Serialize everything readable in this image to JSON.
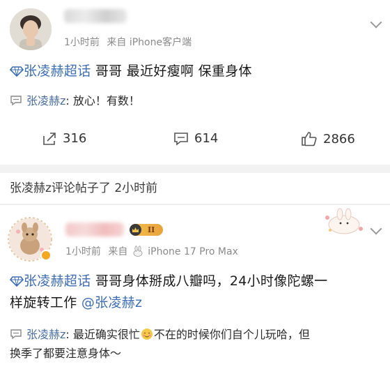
{
  "post1": {
    "time": "1小时前",
    "source_prefix": "来自",
    "source_device": "iPhone客户端",
    "topic": "张凌赫超话",
    "text": " 哥哥 最近好瘦啊 保重身体",
    "comment_user": "张凌赫z",
    "comment_text": ": 放心！有数！",
    "repost_count": "316",
    "comment_count": "614",
    "like_count": "2866"
  },
  "notice": {
    "text": "张凌赫z评论帖子了 2小时前"
  },
  "post2": {
    "badge": "II",
    "time": "1小时前",
    "source_prefix": "来自",
    "source_device": "iPhone 17 Pro Max",
    "topic": "张凌赫超话",
    "text_line1": " 哥哥身体掰成八瓣吗，24小时像陀螺一",
    "text_line2": "样旋转工作 ",
    "mention": "@张凌赫z",
    "comment_user": "张凌赫z",
    "comment_text_a": ": 最近确实很忙",
    "comment_text_b": "不在的时候你们自个儿玩哈，但",
    "comment_text_c": "换季了都要注意身体～"
  },
  "colors": {
    "link": "#3b6db8",
    "meta": "#8a8a8a",
    "divider": "#f2f2f2"
  }
}
